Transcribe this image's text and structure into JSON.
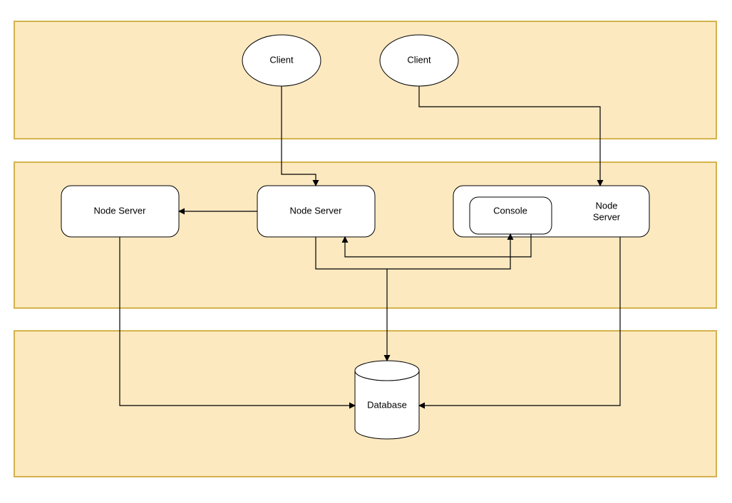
{
  "client1": "Client",
  "client2": "Client",
  "server1": "Node Server",
  "server2": "Node Server",
  "server3": "Node Server",
  "console": "Console",
  "database": "Database"
}
